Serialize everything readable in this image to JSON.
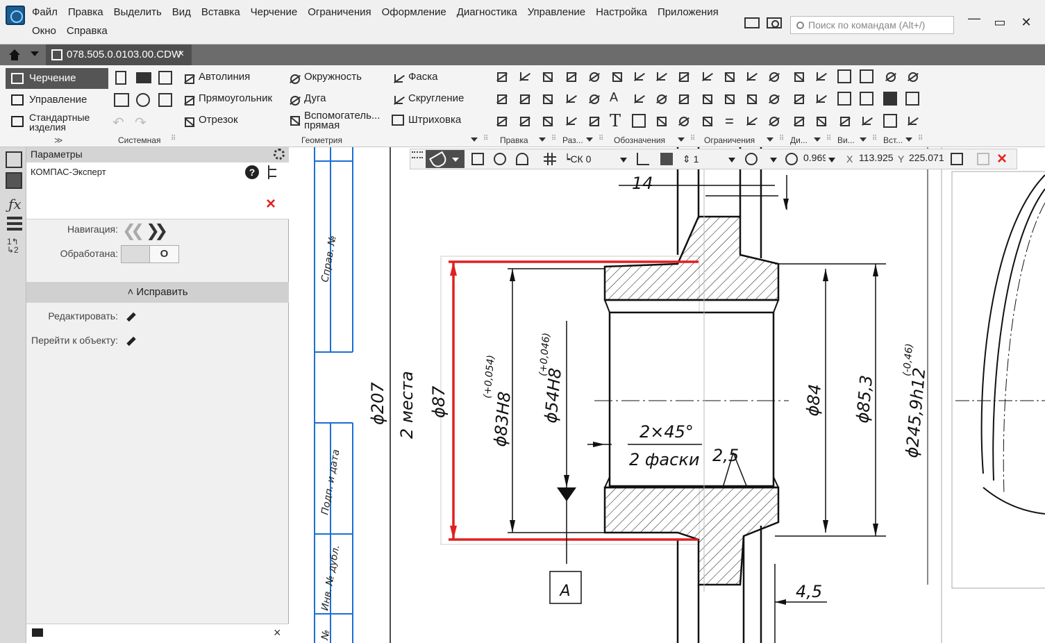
{
  "menu": {
    "items": [
      "Файл",
      "Правка",
      "Выделить",
      "Вид",
      "Вставка",
      "Черчение",
      "Ограничения",
      "Оформление",
      "Диагностика",
      "Управление",
      "Настройка",
      "Приложения",
      "Окно",
      "Справка"
    ],
    "search_placeholder": "Поиск по командам (Alt+/)"
  },
  "tabs": {
    "document": "078.505.0.0103.00.CDW",
    "close": "×"
  },
  "ribbon": {
    "nav": [
      "Черчение",
      "Управление",
      "Стандартные изделия"
    ],
    "groups": [
      "Системная",
      "Геометрия",
      "Правка",
      "Раз...",
      "Обозначения",
      "Ограничения",
      "Ди...",
      "Ви...",
      "Вст..."
    ],
    "geometry_tools": [
      "Автолиния",
      "Прямоугольник",
      "Отрезок",
      "Окружность",
      "Дуга",
      "Вспомогатель... прямая",
      "Фаска",
      "Скругление",
      "Штриховка"
    ]
  },
  "params": {
    "header": "Параметры",
    "expert": "КОМПАС-Эксперт",
    "help": "?",
    "navigation_label": "Навигация:",
    "processed_label": "Обработана:",
    "toggle_value": "O",
    "fix_section": "Исправить",
    "edit_label": "Редактировать:",
    "goto_label": "Перейти к объекту:",
    "close": "×"
  },
  "toolbar": {
    "cs": "СК 0",
    "step": "1",
    "zoom": "0.969",
    "x_label": "X",
    "x_value": "113.925",
    "y_label": "Y",
    "y_value": "225.071"
  },
  "drawing": {
    "labels": {
      "ref": "Справ. №",
      "sign": "Подп. и дата",
      "inv": "Инв. № дубл.",
      "no": "№",
      "d207": "ϕ207",
      "places": "2 места",
      "d87": "ϕ87",
      "d83": "ϕ83H8",
      "tol83": "(+0,054)",
      "d54": "ϕ54H8",
      "tol54": "(+0,046)",
      "chamfer": "2×45°",
      "chamfers": "2 фаски",
      "d25": "2,5",
      "d84": "ϕ84",
      "d853": "ϕ85,3",
      "d245": "ϕ245,9h12",
      "tol245": "(-0,46)",
      "d14": "14",
      "d45": "4,5",
      "section": "А"
    },
    "colors": {
      "highlight": "#e02020",
      "frame": "#1a6fd1"
    }
  }
}
